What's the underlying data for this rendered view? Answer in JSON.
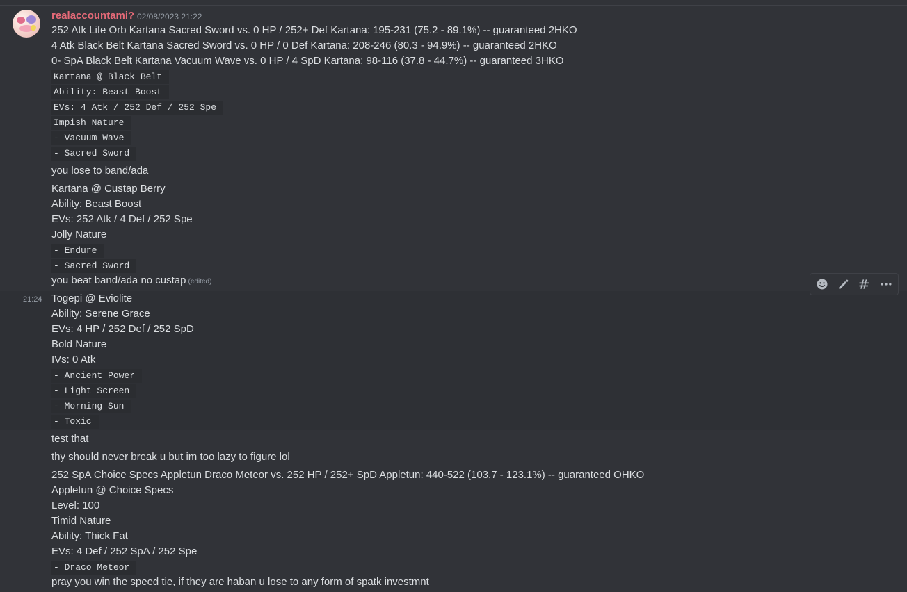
{
  "message1": {
    "username": "realaccountami?",
    "timestamp": "02/08/2023 21:22",
    "lines": [
      "252 Atk Life Orb Kartana Sacred Sword vs. 0 HP / 252+ Def Kartana: 195-231 (75.2 - 89.1%) -- guaranteed 2HKO",
      "4 Atk Black Belt Kartana Sacred Sword vs. 0 HP / 0 Def Kartana: 208-246 (80.3 - 94.9%) -- guaranteed 2HKO",
      "0- SpA Black Belt Kartana Vacuum Wave vs. 0 HP / 4 SpD Kartana: 98-116 (37.8 - 44.7%) -- guaranteed 3HKO"
    ],
    "code1": [
      "Kartana @ Black Belt",
      "Ability: Beast Boost",
      "EVs: 4 Atk / 252 Def / 252 Spe",
      "Impish Nature",
      "- Vacuum Wave",
      "- Sacred Sword"
    ],
    "text2": "you lose to band/ada",
    "lines2": [
      "Kartana @ Custap Berry",
      "Ability: Beast Boost",
      "EVs: 252 Atk / 4 Def / 252 Spe",
      "Jolly Nature"
    ],
    "code2": [
      "- Endure",
      "- Sacred Sword"
    ],
    "text3": "you beat band/ada no custap",
    "edited": "(edited)"
  },
  "message2": {
    "timestamp": "21:24",
    "lines": [
      "Togepi @ Eviolite",
      "Ability: Serene Grace",
      "EVs: 4 HP / 252 Def / 252 SpD",
      "Bold Nature",
      "IVs: 0 Atk"
    ],
    "code": [
      "- Ancient Power",
      "- Light Screen",
      "- Morning Sun",
      "- Toxic"
    ]
  },
  "message3": {
    "text1": "test that",
    "text2": "thy should never break u but im too lazy to figure lol",
    "lines": [
      "252 SpA Choice Specs Appletun Draco Meteor vs. 252 HP / 252+ SpD Appletun: 440-522 (103.7 - 123.1%) -- guaranteed OHKO",
      "Appletun @ Choice Specs",
      "Level: 100",
      "Timid Nature",
      "Ability: Thick Fat",
      "EVs: 4 Def / 252 SpA / 252 Spe"
    ],
    "code": [
      "- Draco Meteor"
    ],
    "text3": "pray you win the speed tie, if they are haban u lose to any form of spatk investmnt"
  },
  "toolbar": {
    "icons": [
      "add-reaction-icon",
      "edit-icon",
      "thread-icon",
      "more-icon"
    ]
  },
  "colors": {
    "background": "#313338",
    "hover_background": "#2e3035",
    "code_background": "#2b2d31",
    "username": "#e66a78",
    "text": "#dbdee1",
    "muted": "#949ba4"
  }
}
